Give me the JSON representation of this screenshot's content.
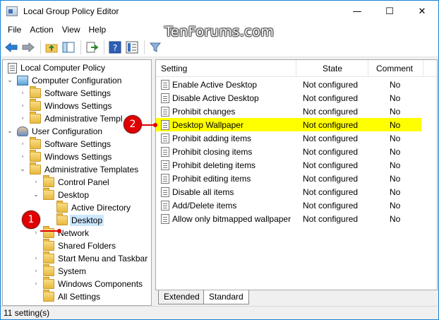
{
  "window": {
    "title": "Local Group Policy Editor",
    "icon": "gpedit-app-icon",
    "controls": {
      "minimize": "—",
      "maximize": "☐",
      "close": "✕"
    }
  },
  "menu": [
    "File",
    "Action",
    "View",
    "Help"
  ],
  "watermark": "TenForums.com",
  "toolbar": {
    "buttons": [
      "back-arrow-icon",
      "forward-arrow-icon",
      "up-folder-icon",
      "show-hide-tree-icon",
      "export-list-icon",
      "help-icon",
      "properties-icon",
      "filter-icon"
    ]
  },
  "tree": {
    "root": "Local Computer Policy",
    "computer_configuration": "Computer Configuration",
    "cc_software_settings": "Software Settings",
    "cc_windows_settings": "Windows Settings",
    "cc_admin_templates": "Administrative Templ",
    "user_configuration": "User Configuration",
    "uc_software_settings": "Software Settings",
    "uc_windows_settings": "Windows Settings",
    "uc_admin_templates": "Administrative Templates",
    "control_panel": "Control Panel",
    "desktop": "Desktop",
    "active_directory": "Active Directory",
    "desktop_sub": "Desktop",
    "network": "Network",
    "shared_folders": "Shared Folders",
    "start_menu": "Start Menu and Taskbar",
    "system": "System",
    "windows_components": "Windows Components",
    "all_settings": "All Settings"
  },
  "list": {
    "columns": {
      "setting": "Setting",
      "state": "State",
      "comment": "Comment"
    },
    "rows": [
      {
        "setting": "Enable Active Desktop",
        "state": "Not configured",
        "comment": "No"
      },
      {
        "setting": "Disable Active Desktop",
        "state": "Not configured",
        "comment": "No"
      },
      {
        "setting": "Prohibit changes",
        "state": "Not configured",
        "comment": "No"
      },
      {
        "setting": "Desktop Wallpaper",
        "state": "Not configured",
        "comment": "No"
      },
      {
        "setting": "Prohibit adding items",
        "state": "Not configured",
        "comment": "No"
      },
      {
        "setting": "Prohibit closing items",
        "state": "Not configured",
        "comment": "No"
      },
      {
        "setting": "Prohibit deleting items",
        "state": "Not configured",
        "comment": "No"
      },
      {
        "setting": "Prohibit editing items",
        "state": "Not configured",
        "comment": "No"
      },
      {
        "setting": "Disable all items",
        "state": "Not configured",
        "comment": "No"
      },
      {
        "setting": "Add/Delete items",
        "state": "Not configured",
        "comment": "No"
      },
      {
        "setting": "Allow only bitmapped wallpaper",
        "state": "Not configured",
        "comment": "No"
      }
    ],
    "highlight_color": "#ffff00"
  },
  "tabs": {
    "extended": "Extended",
    "standard": "Standard"
  },
  "status": "11 setting(s)",
  "callouts": {
    "one": "1",
    "two": "2",
    "color": "#e00000"
  }
}
